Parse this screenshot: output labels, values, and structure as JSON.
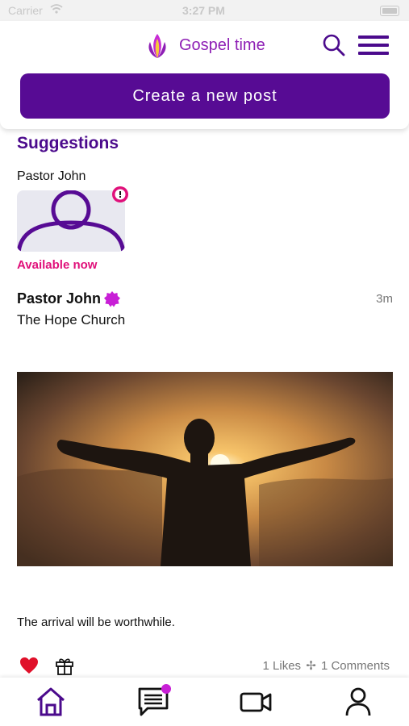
{
  "status_bar": {
    "carrier": "Carrier",
    "time": "3:27 PM"
  },
  "header": {
    "app_title": "Gospel time",
    "create_post_label": "Create a new post"
  },
  "suggestions": {
    "title": "Suggestions",
    "items": [
      {
        "name": "Pastor John",
        "status": "Available now"
      }
    ]
  },
  "post": {
    "author": "Pastor John",
    "organization": "The Hope Church",
    "time": "3m",
    "caption": "The arrival will be worthwhile.",
    "likes": "1 Likes",
    "comments": "1 Comments",
    "separator": "✢"
  },
  "colors": {
    "primary": "#570b94",
    "accent": "#e0107a",
    "title": "#8e1fb5",
    "like": "#e0102a"
  },
  "icons": [
    "logo-icon",
    "search-icon",
    "menu-icon",
    "avatar-icon",
    "alert-icon",
    "verified-icon",
    "heart-icon",
    "gift-icon",
    "home-icon",
    "messages-icon",
    "video-icon",
    "profile-icon"
  ]
}
